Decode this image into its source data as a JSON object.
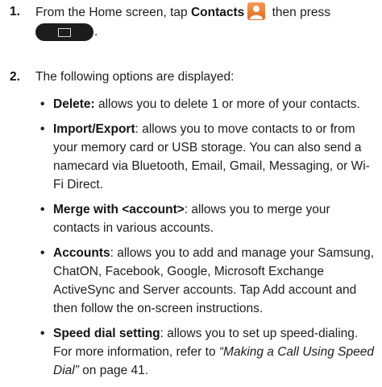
{
  "steps": [
    {
      "num": "1.",
      "pre": "From the Home screen, tap ",
      "bold": "Contacts",
      "post": " then press",
      "after_key": "."
    },
    {
      "num": "2.",
      "text": "The following options are displayed:"
    }
  ],
  "options": [
    {
      "bold": "Delete:",
      "text": " allows you to delete 1 or more of your contacts."
    },
    {
      "bold": "Import/Export",
      "text": ": allows you to move contacts to or from your memory card or USB storage. You can also send a namecard via Bluetooth, Email, Gmail, Messaging, or Wi-Fi Direct."
    },
    {
      "bold": "Merge with <account>",
      "text": ": allows you to merge your contacts in various accounts."
    },
    {
      "bold": "Accounts",
      "text": ": allows you to add and manage your Samsung, ChatON, Facebook, Google, Microsoft Exchange ActiveSync and Server accounts. Tap Add account and then follow the on-screen instructions."
    },
    {
      "bold": "Speed dial setting",
      "text": ": allows you to set up speed-dialing. For more information, refer to ",
      "italic": "“Making a Call Using Speed Dial”",
      "tail": " on page 41."
    }
  ],
  "icons": {
    "contacts": "contacts-icon",
    "menu": "menu-key-icon"
  },
  "colors": {
    "contacts_icon": "#e8772b",
    "menu_key": "#1c1c1c"
  }
}
